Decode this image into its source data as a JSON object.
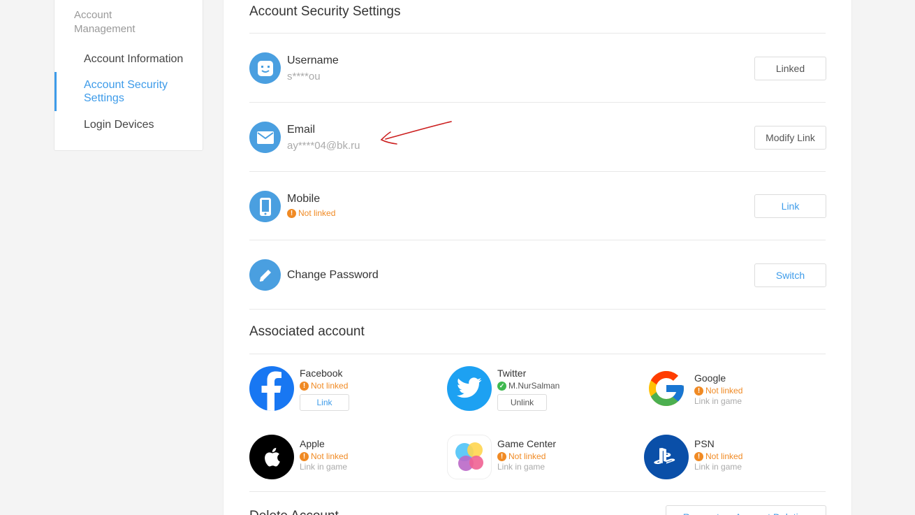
{
  "sidebar": {
    "heading": "Account Management",
    "items": [
      {
        "label": "Account Information"
      },
      {
        "label": "Account Security Settings"
      },
      {
        "label": "Login Devices"
      }
    ]
  },
  "main": {
    "title": "Account Security Settings",
    "rows": [
      {
        "title": "Username",
        "value": "s****ou",
        "button": "Linked",
        "icon": "face-icon"
      },
      {
        "title": "Email",
        "value": "ay****04@bk.ru",
        "button": "Modify Link",
        "icon": "envelope-icon"
      },
      {
        "title": "Mobile",
        "status": "Not linked",
        "button": "Link",
        "icon": "phone-icon"
      },
      {
        "title": "Change Password",
        "button": "Switch",
        "icon": "pencil-icon"
      }
    ]
  },
  "associated": {
    "title": "Associated account",
    "accounts": [
      {
        "name": "Facebook",
        "status": "Not linked",
        "button": "Link",
        "icon": "facebook-icon"
      },
      {
        "name": "Twitter",
        "status": "M.NurSalman",
        "button": "Unlink",
        "icon": "twitter-icon"
      },
      {
        "name": "Google",
        "status": "Not linked",
        "hint": "Link in game",
        "icon": "google-icon"
      },
      {
        "name": "Apple",
        "status": "Not linked",
        "hint": "Link in game",
        "icon": "apple-icon"
      },
      {
        "name": "Game Center",
        "status": "Not linked",
        "hint": "Link in game",
        "icon": "game-center-icon"
      },
      {
        "name": "PSN",
        "status": "Not linked",
        "hint": "Link in game",
        "icon": "playstation-icon"
      }
    ]
  },
  "delete_account": {
    "title": "Delete Account",
    "button": "Request an Account Deletion"
  },
  "colors": {
    "accent": "#3d9be9",
    "warning": "#f08a24",
    "success": "#3fb950",
    "annotation": "#cc1f1f"
  }
}
